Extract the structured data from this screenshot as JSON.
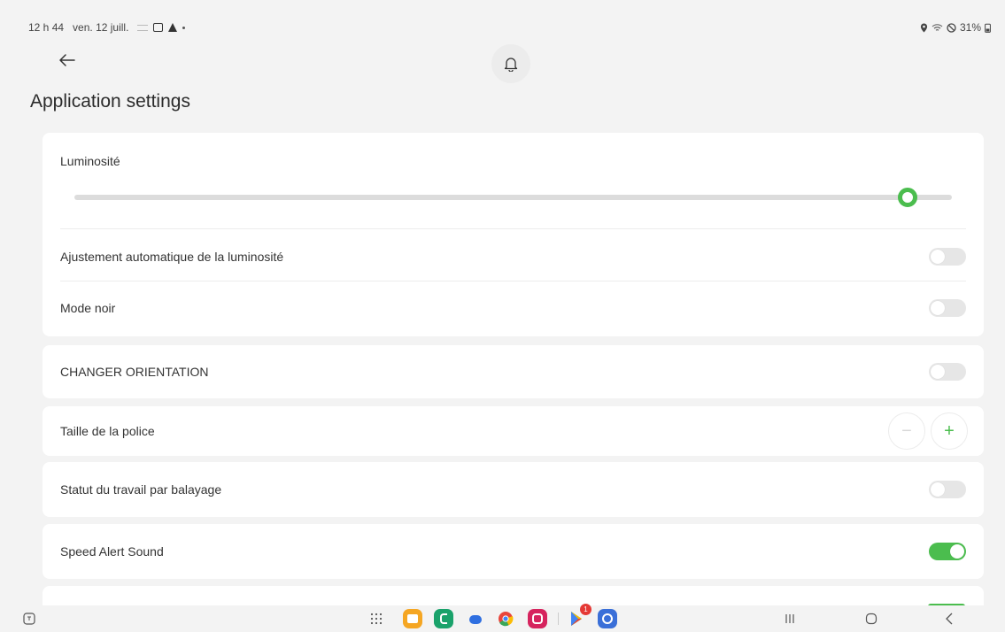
{
  "status_bar": {
    "time": "12 h 44",
    "date": "ven. 12 juill.",
    "battery": "31%"
  },
  "header": {
    "title": "Application settings"
  },
  "settings": {
    "brightness": {
      "label": "Luminosité",
      "value_percent": 95
    },
    "auto_brightness": {
      "label": "Ajustement automatique de la luminosité",
      "enabled": false
    },
    "dark_mode": {
      "label": "Mode noir",
      "enabled": false
    },
    "change_orientation": {
      "label": "CHANGER ORIENTATION",
      "enabled": false
    },
    "font_size": {
      "label": "Taille de la police",
      "minus_symbol": "−",
      "plus_symbol": "+"
    },
    "swipe_work_status": {
      "label": "Statut du travail par balayage",
      "enabled": false
    },
    "speed_alert_sound": {
      "label": "Speed Alert Sound",
      "enabled": true
    }
  },
  "nav": {
    "play_store_badge": "1"
  },
  "colors": {
    "accent": "#4bbd4e",
    "background": "#f3f3f3",
    "card": "#ffffff",
    "toggle_off": "#e6e6e6"
  },
  "icons": {
    "back": "arrow-left-icon",
    "notifications": "bell-icon"
  }
}
